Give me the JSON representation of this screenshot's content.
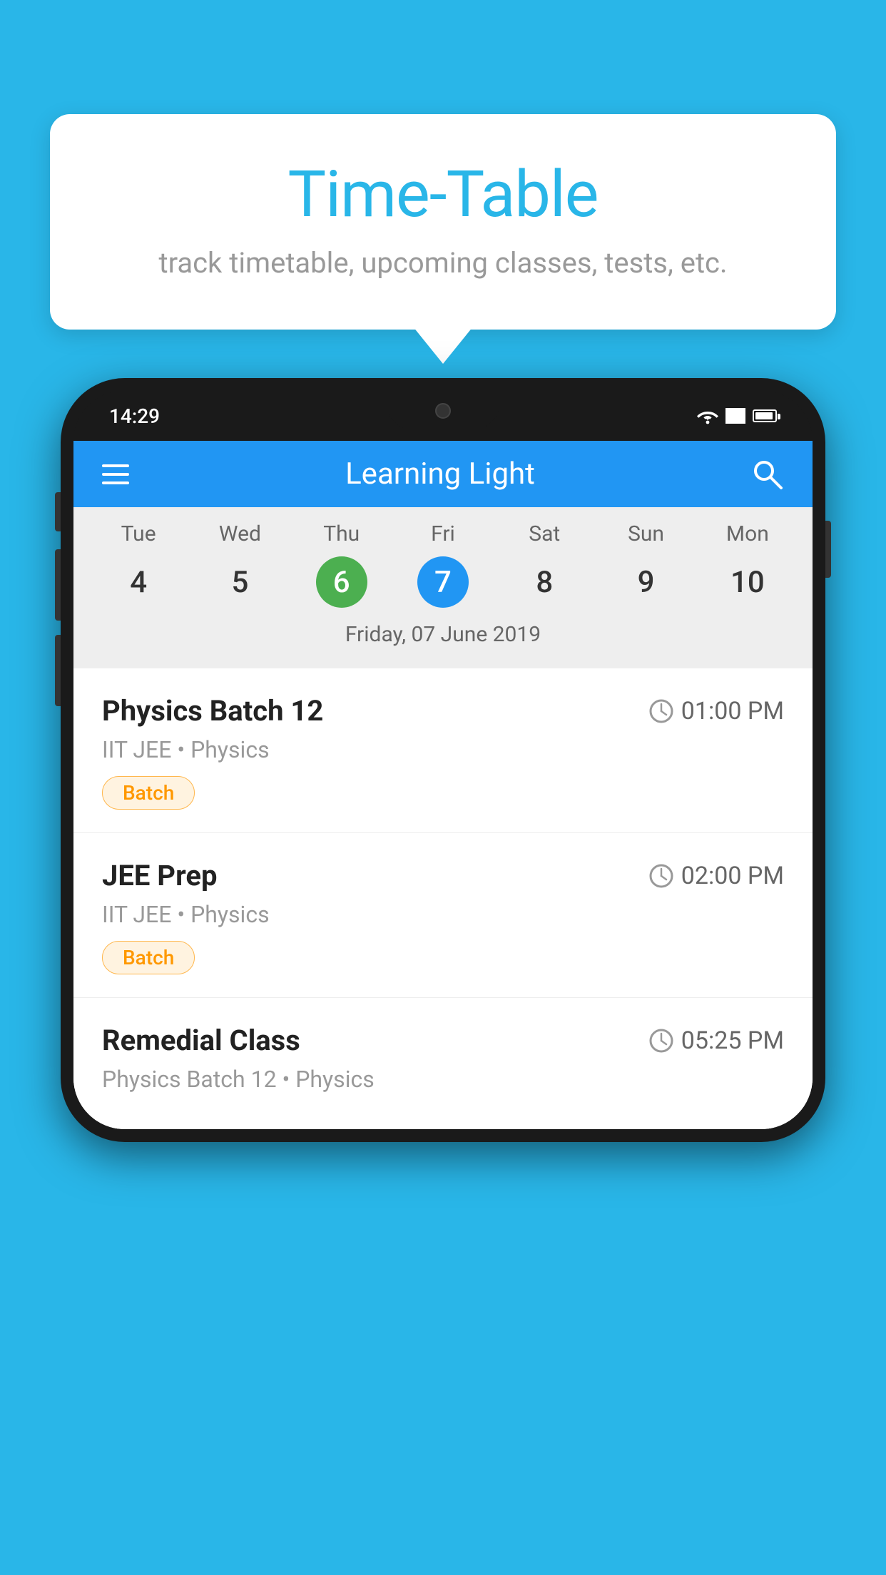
{
  "background_color": "#29B6E8",
  "tooltip": {
    "title": "Time-Table",
    "subtitle": "track timetable, upcoming classes, tests, etc."
  },
  "phone": {
    "status_bar": {
      "time": "14:29"
    },
    "app_header": {
      "title": "Learning Light"
    },
    "calendar": {
      "days": [
        {
          "name": "Tue",
          "num": "4",
          "state": "normal"
        },
        {
          "name": "Wed",
          "num": "5",
          "state": "normal"
        },
        {
          "name": "Thu",
          "num": "6",
          "state": "today"
        },
        {
          "name": "Fri",
          "num": "7",
          "state": "selected"
        },
        {
          "name": "Sat",
          "num": "8",
          "state": "normal"
        },
        {
          "name": "Sun",
          "num": "9",
          "state": "normal"
        },
        {
          "name": "Mon",
          "num": "10",
          "state": "normal"
        }
      ],
      "selected_date_label": "Friday, 07 June 2019"
    },
    "schedule": [
      {
        "title": "Physics Batch 12",
        "time": "01:00 PM",
        "subtitle": "IIT JEE • Physics",
        "badge": "Batch"
      },
      {
        "title": "JEE Prep",
        "time": "02:00 PM",
        "subtitle": "IIT JEE • Physics",
        "badge": "Batch"
      },
      {
        "title": "Remedial Class",
        "time": "05:25 PM",
        "subtitle": "Physics Batch 12 • Physics",
        "badge": null
      }
    ]
  }
}
